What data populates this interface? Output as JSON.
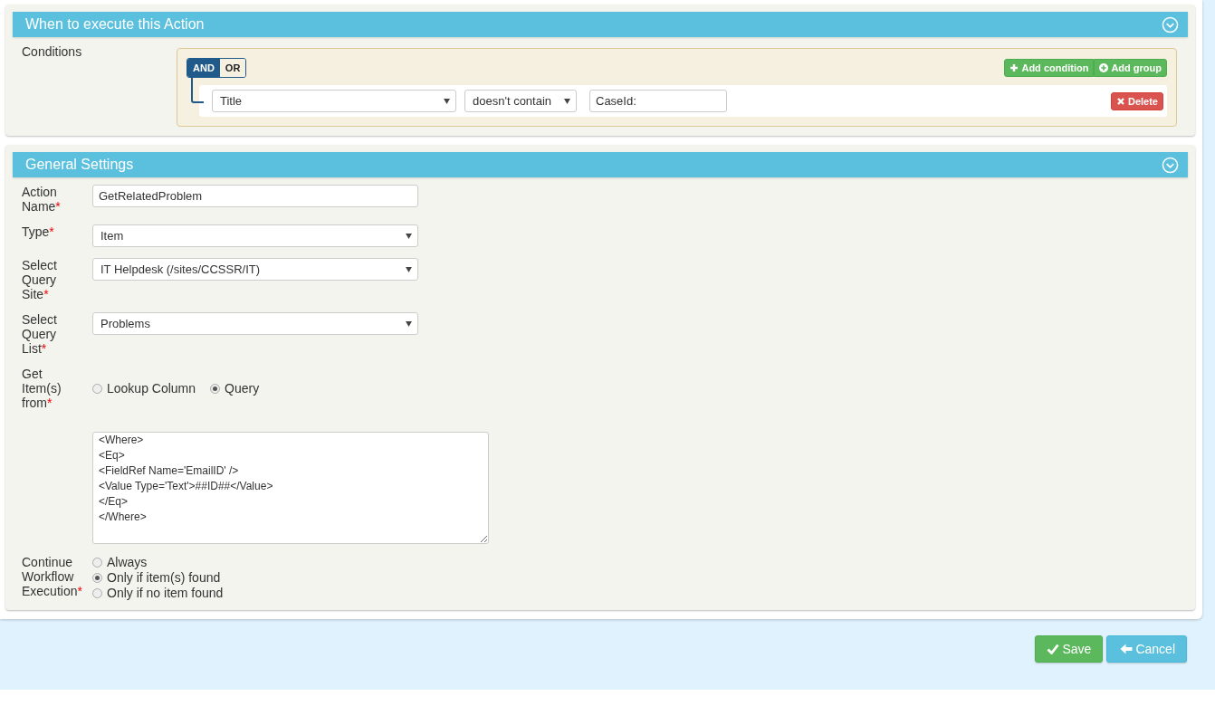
{
  "conditions_panel": {
    "title": "When to execute this Action",
    "label": "Conditions",
    "logic": [
      {
        "label": "AND",
        "selected": true
      },
      {
        "label": "OR",
        "selected": false
      }
    ],
    "add_condition": "Add condition",
    "add_group": "Add group",
    "rule": {
      "field": "Title",
      "operator": "doesn't contain",
      "value": "CaseId:",
      "delete": "Delete"
    }
  },
  "settings_panel": {
    "title": "General Settings",
    "fields": [
      {
        "kind": "text",
        "label": "Action Name",
        "required": "*",
        "value": "GetRelatedProblem"
      },
      {
        "kind": "select",
        "label": "Type",
        "required": "*",
        "value": "Item"
      },
      {
        "kind": "select",
        "label": "Select Query Site",
        "required": "*",
        "value": "IT Helpdesk (/sites/CCSSR/IT)"
      },
      {
        "kind": "select",
        "label": "Select Query List",
        "required": "*",
        "value": "Problems"
      },
      {
        "kind": "radio-inline",
        "label": "Get Item(s) from",
        "required": "*",
        "options": [
          {
            "label": "Lookup Column",
            "selected": false
          },
          {
            "label": "Query",
            "selected": true
          }
        ]
      },
      {
        "kind": "textarea",
        "value": "<Where>\n<Eq>\n<FieldRef Name='EmailID' />\n<Value Type='Text'>##ID##</Value>\n</Eq>\n</Where>"
      },
      {
        "kind": "radio-stack",
        "label": "Continue Workflow Execution",
        "required": "*",
        "options": [
          {
            "label": "Always",
            "selected": false
          },
          {
            "label": "Only if item(s) found",
            "selected": true
          },
          {
            "label": "Only if no item found",
            "selected": false
          }
        ]
      }
    ]
  },
  "buttons": [
    {
      "kind": "save",
      "label": "Save"
    },
    {
      "kind": "cancel",
      "label": "Cancel"
    }
  ]
}
